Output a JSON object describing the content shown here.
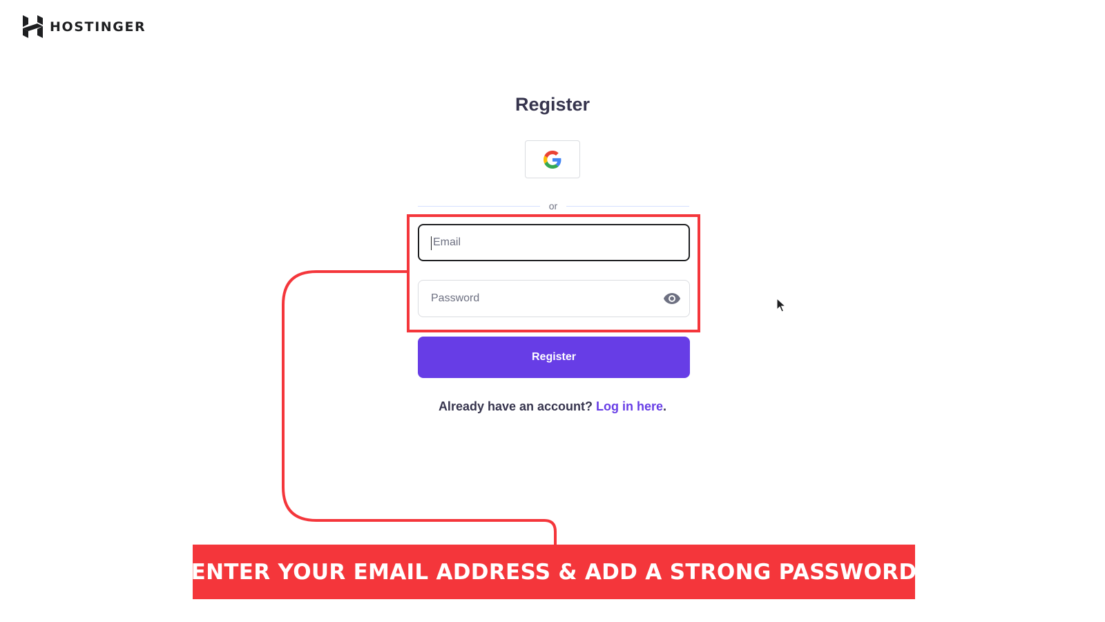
{
  "brand": {
    "name": "HOSTINGER"
  },
  "form": {
    "title": "Register",
    "google_button_label": "Sign up with Google",
    "divider_text": "or",
    "email": {
      "placeholder": "Email",
      "value": ""
    },
    "password": {
      "placeholder": "Password",
      "value": ""
    },
    "submit_label": "Register",
    "login_prompt": "Already have an account?",
    "login_link": "Log in here",
    "login_suffix": "."
  },
  "annotation": {
    "banner_text": "ENTER YOUR EMAIL ADDRESS & ADD A STRONG PASSWORD"
  },
  "colors": {
    "accent": "#673de6",
    "highlight": "#f4363b",
    "text": "#36344d"
  },
  "icons": {
    "logo": "hostinger-logo-icon",
    "google": "google-icon",
    "password_toggle": "eye-icon",
    "pointer": "mouse-cursor-icon"
  }
}
